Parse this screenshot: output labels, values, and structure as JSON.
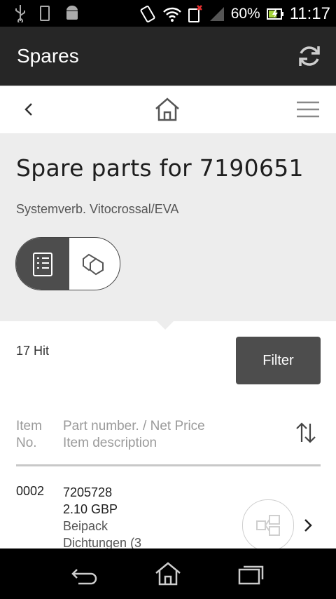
{
  "status_bar": {
    "battery": "60%",
    "time": "11:17",
    "icons": [
      "usb-icon",
      "sd-card-icon",
      "android-icon",
      "vibrate-icon",
      "wifi-icon",
      "no-sim-icon",
      "signal-icon",
      "battery-charging-icon"
    ]
  },
  "app_bar": {
    "title": "Spares",
    "refresh_icon": "refresh-icon"
  },
  "nav": {
    "back_icon": "chevron-left-icon",
    "home_icon": "home-icon",
    "menu_icon": "hamburger-menu-icon"
  },
  "header": {
    "title": "Spare parts for 7190651",
    "subtitle": "Systemverb. Vitocrossal/EVA",
    "view_toggle": {
      "selected": "list",
      "list_icon": "list-view-icon",
      "diagram_icon": "diagram-view-icon"
    }
  },
  "results": {
    "hits": "17 Hit",
    "filter_label": "Filter"
  },
  "table": {
    "col_item_line1": "Item",
    "col_item_line2": "No.",
    "col_part_line1": "Part number. / Net Price",
    "col_part_line2": "Item description",
    "sort_icon": "sort-icon",
    "rows": [
      {
        "item_no": "0002",
        "part_number": "7205728",
        "price": "2.10 GBP",
        "desc_line1": "Beipack",
        "desc_line2": "Dichtungen (3"
      }
    ]
  },
  "bottom_nav": {
    "back_icon": "back-icon",
    "home_icon": "home-icon",
    "recent_icon": "recent-apps-icon"
  }
}
